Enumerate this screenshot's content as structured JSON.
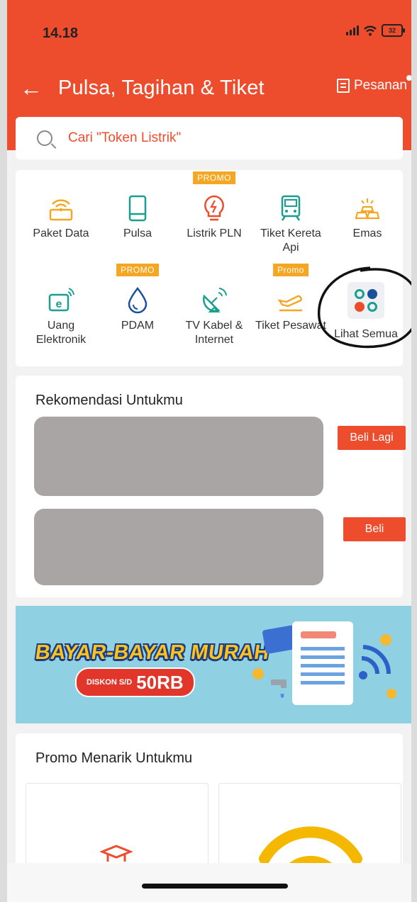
{
  "status_bar": {
    "time": "14.18",
    "battery": "32"
  },
  "header": {
    "title": "Pulsa, Tagihan & Tiket",
    "orders_label": "Pesanan"
  },
  "search": {
    "placeholder": "Cari \"Token Listrik\""
  },
  "services": [
    {
      "label": "Paket Data",
      "icon": "wifi-icon",
      "promo": ""
    },
    {
      "label": "Pulsa",
      "icon": "phone-icon",
      "promo": ""
    },
    {
      "label": "Listrik PLN",
      "icon": "lightbulb-icon",
      "promo": "PROMO"
    },
    {
      "label": "Tiket Kereta Api",
      "icon": "train-icon",
      "promo": ""
    },
    {
      "label": "Emas",
      "icon": "gold-bars-icon",
      "promo": ""
    },
    {
      "label": "Uang Elektronik",
      "icon": "e-money-icon",
      "promo": ""
    },
    {
      "label": "PDAM",
      "icon": "water-drop-icon",
      "promo": "PROMO"
    },
    {
      "label": "TV Kabel & Internet",
      "icon": "satellite-dish-icon",
      "promo": ""
    },
    {
      "label": "Tiket Pesawat",
      "icon": "airplane-icon",
      "promo": "Promo"
    },
    {
      "label": "Lihat Semua",
      "icon": "grid-apps-icon",
      "promo": ""
    }
  ],
  "recommendations": {
    "title": "Rekomendasi Untukmu",
    "items": [
      {
        "button": "Beli Lagi"
      },
      {
        "button": "Beli"
      }
    ]
  },
  "banner": {
    "title": "BAYAR-BAYAR MURAH",
    "discount_prefix": "DISKON S/D",
    "discount_value": "50RB"
  },
  "promo_section": {
    "title": "Promo Menarik Untukmu"
  },
  "colors": {
    "brand": "#ee4d2d",
    "promo_tag": "#f5a623",
    "icon_accent": "#f5a623",
    "icon_teal": "#1a9e8f"
  }
}
